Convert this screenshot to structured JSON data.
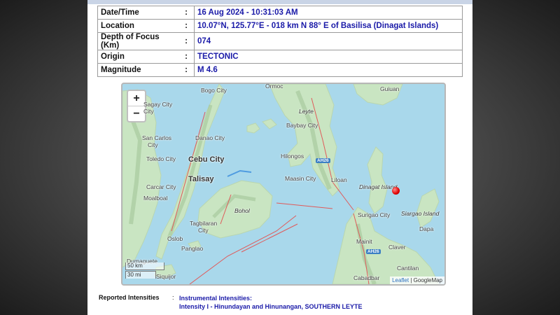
{
  "info_rows": [
    {
      "label": "Date/Time",
      "separator": ":",
      "value": "16 Aug 2024 - 10:31:03 AM"
    },
    {
      "label": "Location",
      "separator": ":",
      "value": "10.07°N, 125.77°E - 018 km N 88° E of Basilisa (Dinagat Islands)"
    },
    {
      "label": "Depth of Focus (Km)",
      "separator": ":",
      "value": "074"
    },
    {
      "label": "Origin",
      "separator": ":",
      "value": "TECTONIC"
    },
    {
      "label": "Magnitude",
      "separator": ":",
      "value": "M 4.6"
    }
  ],
  "map": {
    "zoom_in": "+",
    "zoom_out": "−",
    "labels": {
      "bogo": "Bogo City",
      "ormoc": "Ormoc",
      "guiuan": "Guiuan",
      "sagay": "Sagay City",
      "city": "City",
      "leyte": "Leyte",
      "baybay": "Baybay City",
      "san_carlos": "San Carlos",
      "city2": "City",
      "danao": "Danao City",
      "toledo": "Toledo City",
      "hilongos": "Hilongos",
      "cebu": "Cebu City",
      "talisay": "Talisay",
      "maasin": "Maasin City",
      "liloan": "Liloan",
      "dinagat": "Dinagat Island",
      "carcar": "Carcar City",
      "moalboal": "Moalboal",
      "bohol": "Bohol",
      "surigao": "Surigao City",
      "siargao": "Siargao Island",
      "tagbilaran": "Tagbilaran",
      "city3": "City",
      "dapa": "Dapa",
      "oslob": "Oslob",
      "panglao": "Panglao",
      "mainit": "Mainit",
      "claver": "Claver",
      "dumaguete": "Dumaguete",
      "siquijor": "Siquijor",
      "cantilan": "Cantilan",
      "cabadbaran": "Cabadbar"
    },
    "road_labels": [
      "AH26",
      "AH26"
    ],
    "scale": {
      "km": "50 km",
      "mi": "30 mi"
    },
    "attribution": {
      "leaflet": "Leaflet",
      "separator": " | ",
      "google": "GoogleMap"
    }
  },
  "reported": {
    "label": "Reported Intensities",
    "separator": ":",
    "heading": "Instrumental Intensities:",
    "line1": "Intensity I - Hinundayan and Hinunangan, SOUTHERN LEYTE"
  },
  "colors": {
    "value_text": "#1a1aa8",
    "water": "#a9d8eb",
    "land": "#c9e5c2",
    "epicenter": "#e00000"
  }
}
